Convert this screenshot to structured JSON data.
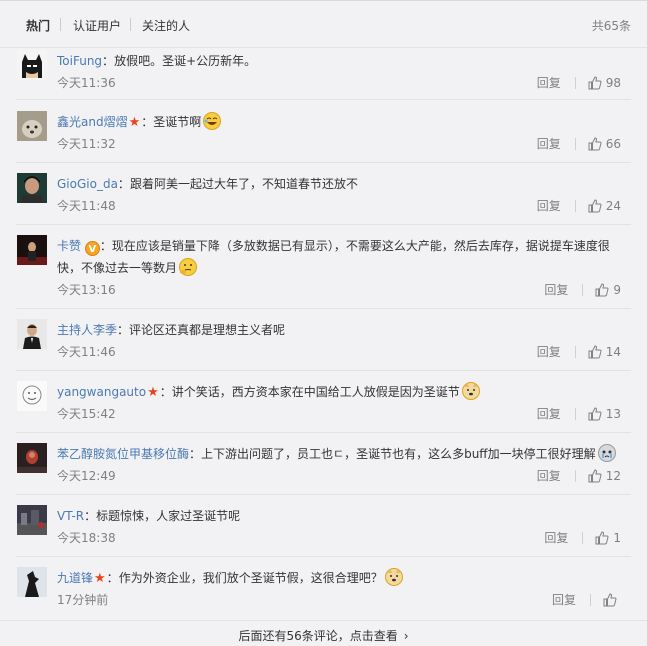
{
  "tabs": {
    "hot": "热门",
    "verified": "认证用户",
    "following": "关注的人",
    "total": "共65条"
  },
  "comments": [
    {
      "user": "ToiFung",
      "sep": "：",
      "text": "放假吧。圣诞+公历新年。",
      "time": "今天11:36",
      "reply": "回复",
      "likes": "98",
      "avatar": "batman-avatar"
    },
    {
      "user": "鑫光and熠熠",
      "sep": "：",
      "text": "圣诞节啊",
      "time": "今天11:32",
      "reply": "回复",
      "likes": "66",
      "avatar": "dog-avatar",
      "emoji": "laughing-emoji"
    },
    {
      "user": "GioGio_da",
      "sep": "：",
      "text": "跟着阿美一起过大年了，不知道春节还放不",
      "time": "今天11:48",
      "reply": "回复",
      "likes": "24",
      "avatar": "person-avatar"
    },
    {
      "user": "卡赞",
      "sep": "：",
      "text": "现在应该是销量下降（多放数据已有显示），不需要这么大产能，然后去库存，据说提车速度很快，不像过去一等数月",
      "time": "今天13:16",
      "reply": "回复",
      "likes": "9",
      "avatar": "stage-avatar",
      "emoji": "thinking-emoji"
    },
    {
      "user": "主持人李季",
      "sep": "：",
      "text": "评论区还真都是理想主义者呢",
      "time": "今天11:46",
      "reply": "回复",
      "likes": "14",
      "avatar": "host-avatar"
    },
    {
      "user": "yangwangauto",
      "sep": "：",
      "text": "讲个笑话，西方资本家在中国给工人放假是因为圣诞节",
      "time": "今天15:42",
      "reply": "回复",
      "likes": "13",
      "avatar": "sketch-avatar",
      "emoji": "doge-emoji"
    },
    {
      "user": "苯乙醇胺氮位甲基移位酶",
      "sep": "：",
      "text": "上下游出问题了，员工也ㄷ，圣诞节也有，这么多buff加一块停工很好理解",
      "time": "今天12:49",
      "reply": "回复",
      "likes": "12",
      "avatar": "red-avatar",
      "emoji": "crying-emoji"
    },
    {
      "user": "VT-R",
      "sep": "：",
      "text": "标题惊悚，人家过圣诞节呢",
      "time": "今天18:38",
      "reply": "回复",
      "likes": "1",
      "avatar": "street-avatar"
    },
    {
      "user": "九道锋",
      "sep": "：",
      "text": "作为外资企业，我们放个圣诞节假，这很合理吧？",
      "time": "17分钟前",
      "reply": "回复",
      "likes": "",
      "avatar": "silhouette-avatar",
      "emoji": "doge-emoji"
    }
  ],
  "more": "后面还有56条评论，点击查看",
  "colors": {
    "username": "#eb7350",
    "link": "#4a7ab0",
    "muted": "#808080",
    "background": "#f2f2f5"
  }
}
